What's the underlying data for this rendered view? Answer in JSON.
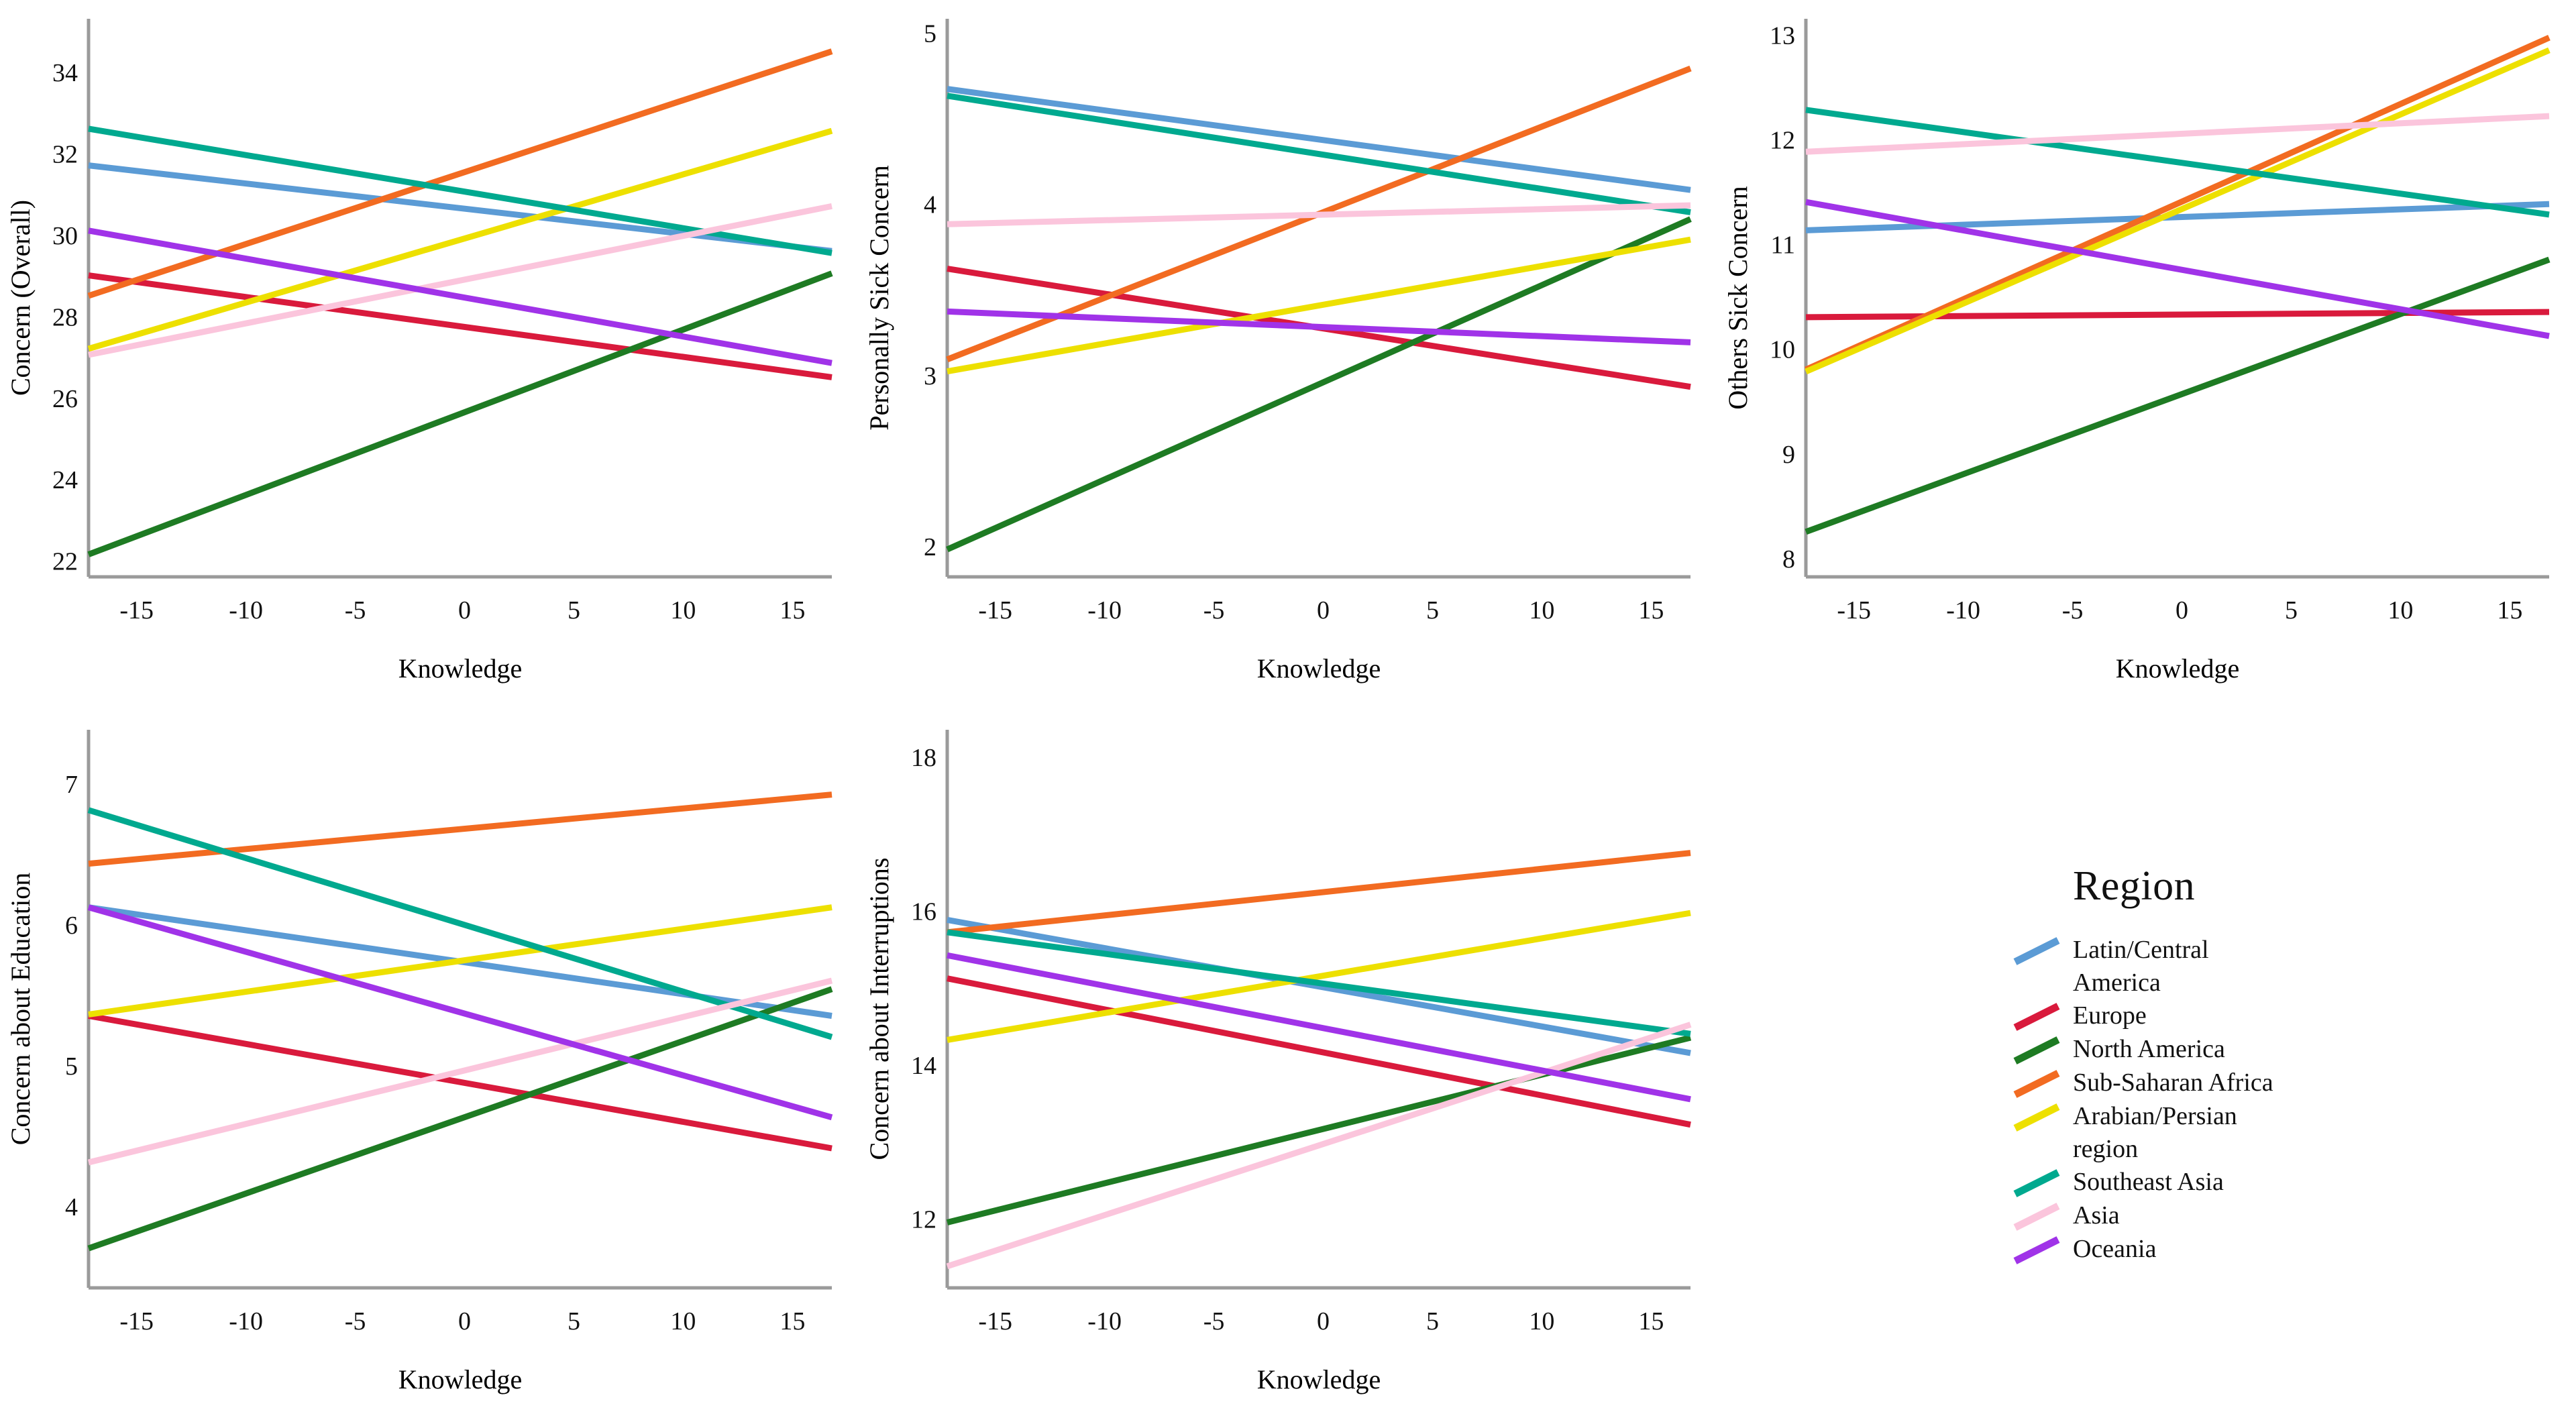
{
  "legend": {
    "title": "Region",
    "entries": [
      {
        "label": "Latin/Central\nAmerica",
        "color": "#5B9BD5"
      },
      {
        "label": "Europe",
        "color": "#D91A3C"
      },
      {
        "label": "North America",
        "color": "#1E7B23"
      },
      {
        "label": "Sub-Saharan Africa",
        "color": "#F26B21"
      },
      {
        "label": "Arabian/Persian\nregion",
        "color": "#EDE000"
      },
      {
        "label": "Southeast Asia",
        "color": "#00A98F"
      },
      {
        "label": "Asia",
        "color": "#FBC5DC"
      },
      {
        "label": "Oceania",
        "color": "#A033E8"
      }
    ]
  },
  "shared": {
    "xlabel": "Knowledge",
    "xticks": [
      -15,
      -10,
      -5,
      0,
      5,
      10,
      15
    ],
    "xlim": [
      -17.2,
      16.8
    ],
    "regions": [
      "Latin/Central America",
      "Europe",
      "North America",
      "Sub-Saharan Africa",
      "Arabian/Persian region",
      "Southeast Asia",
      "Asia",
      "Oceania"
    ],
    "colors": [
      "#5B9BD5",
      "#D91A3C",
      "#1E7B23",
      "#F26B21",
      "#EDE000",
      "#00A98F",
      "#FBC5DC",
      "#A033E8"
    ]
  },
  "chart_data": [
    {
      "type": "line",
      "title": "",
      "xlabel": "Knowledge",
      "ylabel": "Concern (Overall)",
      "xlim": [
        -17.2,
        16.8
      ],
      "ylim": [
        21.6,
        35.3
      ],
      "yticks": [
        22,
        24,
        26,
        28,
        30,
        32,
        34
      ],
      "xticks": [
        -15,
        -10,
        -5,
        0,
        5,
        10,
        15
      ],
      "grid": false,
      "x": [
        -17.2,
        16.8
      ],
      "series": [
        {
          "name": "Latin/Central America",
          "color": "#5B9BD5",
          "values": [
            31.7,
            29.6
          ]
        },
        {
          "name": "Europe",
          "color": "#D91A3C",
          "values": [
            29.0,
            26.5
          ]
        },
        {
          "name": "North America",
          "color": "#1E7B23",
          "values": [
            22.15,
            29.05
          ]
        },
        {
          "name": "Sub-Saharan Africa",
          "color": "#F26B21",
          "values": [
            28.5,
            34.5
          ]
        },
        {
          "name": "Arabian/Persian region",
          "color": "#EDE000",
          "values": [
            27.2,
            32.55
          ]
        },
        {
          "name": "Southeast Asia",
          "color": "#00A98F",
          "values": [
            32.6,
            29.55
          ]
        },
        {
          "name": "Asia",
          "color": "#FBC5DC",
          "values": [
            27.05,
            30.7
          ]
        },
        {
          "name": "Oceania",
          "color": "#A033E8",
          "values": [
            30.1,
            26.85
          ]
        }
      ]
    },
    {
      "type": "line",
      "title": "",
      "xlabel": "Knowledge",
      "ylabel": "Personally Sick Concern",
      "xlim": [
        -17.2,
        16.8
      ],
      "ylim": [
        1.82,
        5.08
      ],
      "yticks": [
        2,
        3,
        4,
        5
      ],
      "xticks": [
        -15,
        -10,
        -5,
        0,
        5,
        10,
        15
      ],
      "grid": false,
      "x": [
        -17.2,
        16.8
      ],
      "series": [
        {
          "name": "Latin/Central America",
          "color": "#5B9BD5",
          "values": [
            4.67,
            4.08
          ]
        },
        {
          "name": "Europe",
          "color": "#D91A3C",
          "values": [
            3.62,
            2.93
          ]
        },
        {
          "name": "North America",
          "color": "#1E7B23",
          "values": [
            1.98,
            3.91
          ]
        },
        {
          "name": "Sub-Saharan Africa",
          "color": "#F26B21",
          "values": [
            3.09,
            4.79
          ]
        },
        {
          "name": "Arabian/Persian region",
          "color": "#EDE000",
          "values": [
            3.02,
            3.79
          ]
        },
        {
          "name": "Southeast Asia",
          "color": "#00A98F",
          "values": [
            4.63,
            3.95
          ]
        },
        {
          "name": "Asia",
          "color": "#FBC5DC",
          "values": [
            3.88,
            3.99
          ]
        },
        {
          "name": "Oceania",
          "color": "#A033E8",
          "values": [
            3.37,
            3.19
          ]
        }
      ]
    },
    {
      "type": "line",
      "title": "",
      "xlabel": "Knowledge",
      "ylabel": "Others Sick Concern",
      "xlim": [
        -17.2,
        16.8
      ],
      "ylim": [
        7.82,
        13.15
      ],
      "yticks": [
        8,
        9,
        10,
        11,
        12,
        13
      ],
      "xticks": [
        -15,
        -10,
        -5,
        0,
        5,
        10,
        15
      ],
      "grid": false,
      "x": [
        -17.2,
        16.8
      ],
      "series": [
        {
          "name": "Latin/Central America",
          "color": "#5B9BD5",
          "values": [
            11.13,
            11.38
          ]
        },
        {
          "name": "Europe",
          "color": "#D91A3C",
          "values": [
            10.3,
            10.35
          ]
        },
        {
          "name": "North America",
          "color": "#1E7B23",
          "values": [
            8.25,
            10.85
          ]
        },
        {
          "name": "Sub-Saharan Africa",
          "color": "#F26B21",
          "values": [
            9.8,
            12.97
          ]
        },
        {
          "name": "Arabian/Persian region",
          "color": "#EDE000",
          "values": [
            9.78,
            12.85
          ]
        },
        {
          "name": "Southeast Asia",
          "color": "#00A98F",
          "values": [
            12.28,
            11.28
          ]
        },
        {
          "name": "Asia",
          "color": "#FBC5DC",
          "values": [
            11.88,
            12.22
          ]
        },
        {
          "name": "Oceania",
          "color": "#A033E8",
          "values": [
            11.4,
            10.12
          ]
        }
      ]
    },
    {
      "type": "line",
      "title": "",
      "xlabel": "Knowledge",
      "ylabel": "Concern about Education",
      "xlim": [
        -17.2,
        16.8
      ],
      "ylim": [
        3.42,
        7.38
      ],
      "yticks": [
        4,
        5,
        6,
        7
      ],
      "xticks": [
        -15,
        -10,
        -5,
        0,
        5,
        10,
        15
      ],
      "grid": false,
      "x": [
        -17.2,
        16.8
      ],
      "series": [
        {
          "name": "Latin/Central America",
          "color": "#5B9BD5",
          "values": [
            6.12,
            5.35
          ]
        },
        {
          "name": "Europe",
          "color": "#D91A3C",
          "values": [
            5.35,
            4.41
          ]
        },
        {
          "name": "North America",
          "color": "#1E7B23",
          "values": [
            3.7,
            5.54
          ]
        },
        {
          "name": "Sub-Saharan Africa",
          "color": "#F26B21",
          "values": [
            6.43,
            6.92
          ]
        },
        {
          "name": "Arabian/Persian region",
          "color": "#EDE000",
          "values": [
            5.36,
            6.12
          ]
        },
        {
          "name": "Southeast Asia",
          "color": "#00A98F",
          "values": [
            6.81,
            5.2
          ]
        },
        {
          "name": "Asia",
          "color": "#FBC5DC",
          "values": [
            4.31,
            5.6
          ]
        },
        {
          "name": "Oceania",
          "color": "#A033E8",
          "values": [
            6.12,
            4.63
          ]
        }
      ]
    },
    {
      "type": "line",
      "title": "",
      "xlabel": "Knowledge",
      "ylabel": "Concern about Interruptions",
      "xlim": [
        -17.2,
        16.8
      ],
      "ylim": [
        11.1,
        18.35
      ],
      "yticks": [
        12,
        14,
        16,
        18
      ],
      "xticks": [
        -15,
        -10,
        -5,
        0,
        5,
        10,
        15
      ],
      "grid": false,
      "x": [
        -17.2,
        16.8
      ],
      "series": [
        {
          "name": "Latin/Central America",
          "color": "#5B9BD5",
          "values": [
            15.88,
            14.15
          ]
        },
        {
          "name": "Europe",
          "color": "#D91A3C",
          "values": [
            15.12,
            13.22
          ]
        },
        {
          "name": "North America",
          "color": "#1E7B23",
          "values": [
            11.95,
            14.35
          ]
        },
        {
          "name": "Sub-Saharan Africa",
          "color": "#F26B21",
          "values": [
            15.72,
            16.75
          ]
        },
        {
          "name": "Arabian/Persian region",
          "color": "#EDE000",
          "values": [
            14.32,
            15.97
          ]
        },
        {
          "name": "Southeast Asia",
          "color": "#00A98F",
          "values": [
            15.72,
            14.4
          ]
        },
        {
          "name": "Asia",
          "color": "#FBC5DC",
          "values": [
            11.38,
            14.52
          ]
        },
        {
          "name": "Oceania",
          "color": "#A033E8",
          "values": [
            15.42,
            13.55
          ]
        }
      ]
    }
  ]
}
